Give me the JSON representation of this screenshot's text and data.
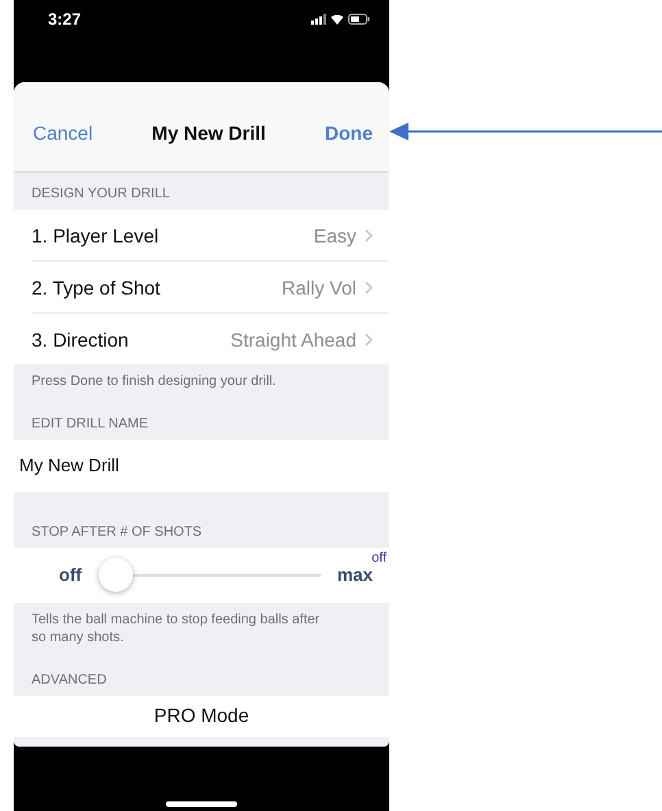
{
  "status_bar": {
    "time": "3:27"
  },
  "nav": {
    "cancel": "Cancel",
    "title": "My New Drill",
    "done": "Done"
  },
  "sections": [
    {
      "kind": "menu",
      "header": "DESIGN YOUR DRILL",
      "rows": [
        {
          "label": "1. Player Level",
          "value": "Easy"
        },
        {
          "label": "2. Type of Shot",
          "value": "Rally Vol"
        },
        {
          "label": "3. Direction",
          "value": "Straight Ahead"
        }
      ],
      "footer": "Press Done to finish designing your drill."
    },
    {
      "kind": "text",
      "header": "EDIT DRILL NAME",
      "value": "My New Drill"
    },
    {
      "kind": "slider",
      "header": "STOP AFTER # OF SHOTS",
      "min_label": "off",
      "max_label": "max",
      "level": 0,
      "reading": "off",
      "footer": "Tells the ball machine to stop feeding balls after so many shots."
    },
    {
      "kind": "button",
      "header": "ADVANCED",
      "label": "PRO Mode"
    }
  ]
}
